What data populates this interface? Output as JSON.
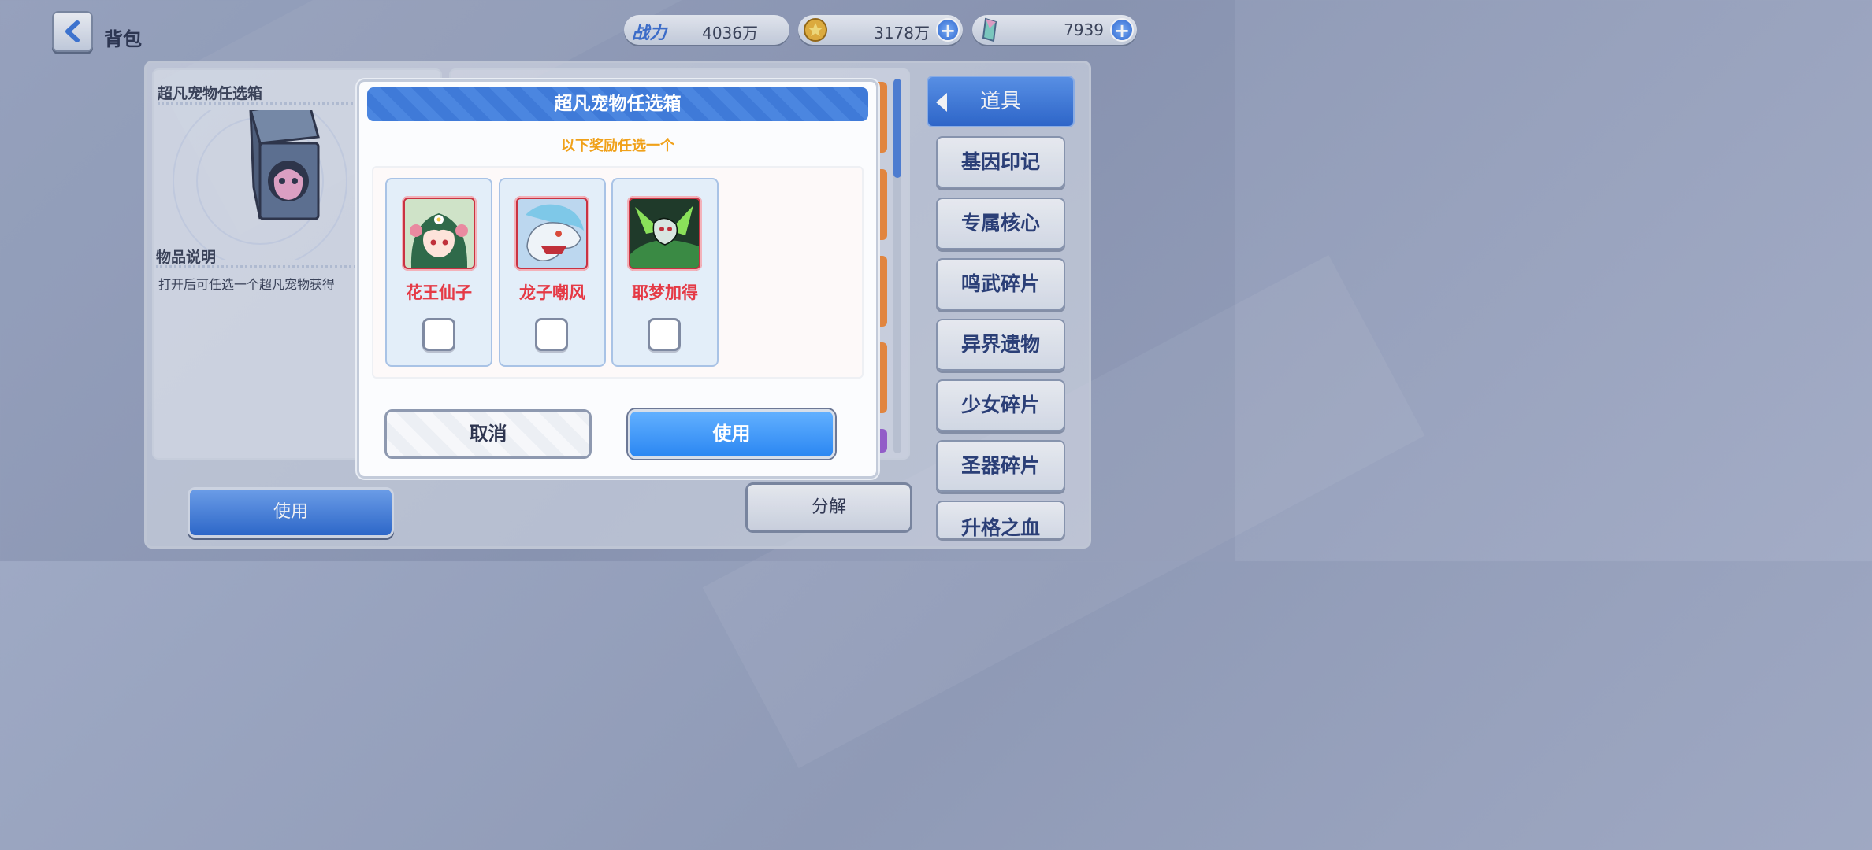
{
  "header": {
    "title": "背包",
    "power_label": "战力",
    "power_value": "4036万",
    "gold_value": "3178万",
    "gem_value": "7939"
  },
  "item": {
    "name": "超凡宠物任选箱",
    "desc_title": "物品说明",
    "desc_text": "打开后可任选一个超凡宠物获得"
  },
  "actions": {
    "use_label": "使用",
    "decompose_label": "分解"
  },
  "nav": {
    "active": "道具",
    "items": [
      "基因印记",
      "专属核心",
      "鸣武碎片",
      "异界遗物",
      "少女碎片",
      "圣器碎片",
      "升格之血"
    ]
  },
  "modal": {
    "title": "超凡宠物任选箱",
    "subtitle": "以下奖励任选一个",
    "choices": [
      {
        "name": "花王仙子",
        "checked": false
      },
      {
        "name": "龙子嘲风",
        "checked": false
      },
      {
        "name": "耶梦加得",
        "checked": false
      }
    ],
    "cancel_label": "取消",
    "confirm_label": "使用"
  },
  "colors": {
    "accent_blue": "#2b87f2",
    "title_orange": "#f0a11a",
    "pet_name_red": "#e53a46"
  }
}
